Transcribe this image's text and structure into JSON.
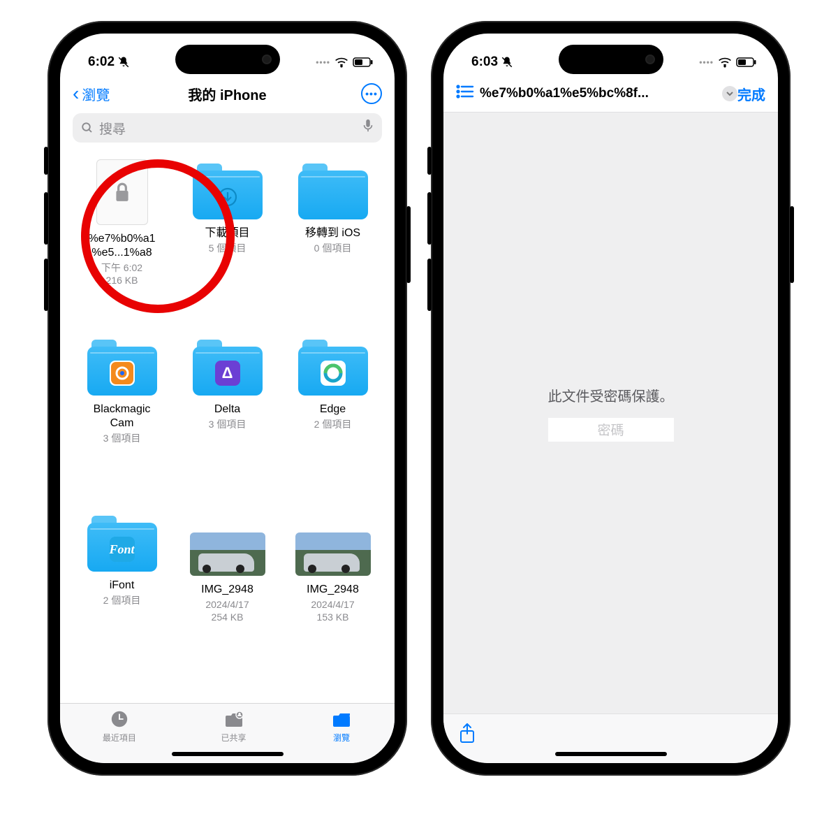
{
  "phone1": {
    "status": {
      "time": "6:02"
    },
    "nav": {
      "back": "瀏覽",
      "title": "我的 iPhone"
    },
    "search": {
      "placeholder": "搜尋"
    },
    "items": [
      {
        "kind": "doc",
        "name_l1": "%e7%b0%a1",
        "name_l2": "%e5...1%a8",
        "sub1": "下午 6:02",
        "sub2": "216 KB"
      },
      {
        "kind": "folder",
        "name": "下載項目",
        "sub": "5 個項目",
        "overlay": "dl"
      },
      {
        "kind": "folder",
        "name": "移轉到 iOS",
        "sub": "0 個項目"
      },
      {
        "kind": "folder",
        "name_l1": "Blackmagic",
        "name_l2": "Cam",
        "sub": "3 個項目",
        "overlay": "orange"
      },
      {
        "kind": "folder",
        "name": "Delta",
        "sub": "3 個項目",
        "overlay": "purple"
      },
      {
        "kind": "folder",
        "name": "Edge",
        "sub": "2 個項目",
        "overlay": "teal"
      },
      {
        "kind": "folder",
        "name": "iFont",
        "sub": "2 個項目",
        "overlay": "font"
      },
      {
        "kind": "photo",
        "name": "IMG_2948",
        "sub1": "2024/4/17",
        "sub2": "254 KB"
      },
      {
        "kind": "photo",
        "name": "IMG_2948",
        "sub1": "2024/4/17",
        "sub2": "153 KB"
      }
    ],
    "tabs": {
      "recent": "最近項目",
      "shared": "已共享",
      "browse": "瀏覽"
    }
  },
  "phone2": {
    "status": {
      "time": "6:03"
    },
    "nav": {
      "title": "%e7%b0%a1%e5%bc%8f...",
      "done": "完成"
    },
    "viewer": {
      "msg": "此文件受密碼保護。",
      "pw_placeholder": "密碼"
    }
  }
}
